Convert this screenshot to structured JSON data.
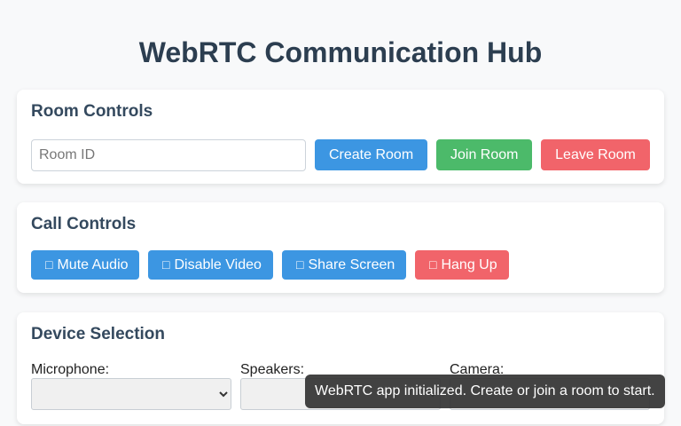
{
  "app": {
    "title": "WebRTC Communication Hub"
  },
  "room_controls": {
    "title": "Room Controls",
    "room_input": {
      "placeholder": "Room ID",
      "value": ""
    },
    "create_label": "Create Room",
    "join_label": "Join Room",
    "leave_label": "Leave Room"
  },
  "call_controls": {
    "title": "Call Controls",
    "mute": {
      "icon": "microphone-icon",
      "label": "Mute Audio"
    },
    "video": {
      "icon": "video-icon",
      "label": "Disable Video"
    },
    "share": {
      "icon": "screen-share-icon",
      "label": "Share Screen"
    },
    "hangup": {
      "icon": "phone-icon",
      "label": "Hang Up"
    }
  },
  "device_selection": {
    "title": "Device Selection",
    "microphone_label": "Microphone:",
    "speakers_label": "Speakers:",
    "camera_label": "Camera:"
  },
  "toast": {
    "message": "WebRTC app initialized. Create or join a room to start."
  },
  "colors": {
    "primary": "#3c96e2",
    "success": "#4cba6a",
    "danger": "#f1646a",
    "heading": "#2c3e50"
  }
}
